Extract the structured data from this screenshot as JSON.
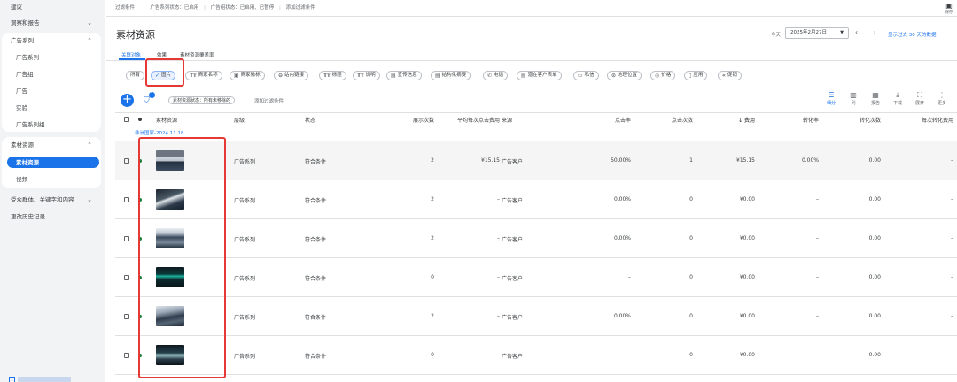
{
  "sidebar": {
    "items_top": [
      {
        "label": "建议"
      },
      {
        "label": "洞察和报告",
        "chev": "⌄"
      }
    ],
    "group_ads": {
      "label": "广告系列",
      "chev": "⌃",
      "items": [
        "广告系列",
        "广告组",
        "广告",
        "实验",
        "广告系列组"
      ]
    },
    "group_assets": {
      "label": "素材资源",
      "chev": "⌃",
      "items": [
        "素材资源",
        "视频"
      ]
    },
    "items_bottom": [
      {
        "label": "受众群体、关键字和内容",
        "chev": "⌄"
      },
      {
        "label": "更改历史记录"
      }
    ]
  },
  "filterbar": {
    "items": [
      "过滤条件",
      "广告系列状态：已启用",
      "广告组状态：已启用、已暂停",
      "添加过滤条件"
    ],
    "save_label": "保存"
  },
  "header": {
    "title": "素材资源",
    "date_prefix": "今天",
    "date_value": "2025年2月27日",
    "date_compare": "显示过去 30 天的数据"
  },
  "tabs": [
    "关联对象",
    "效果",
    "素材资源覆盖率"
  ],
  "type_chips": [
    {
      "icon": "",
      "label": "所有"
    },
    {
      "icon": "✓",
      "label": "图片"
    },
    {
      "icon": "Tт",
      "label": "商家名称"
    },
    {
      "icon": "▣",
      "label": "商家徽标"
    },
    {
      "icon": "⊖",
      "label": "站内链接"
    },
    {
      "icon": "Tт",
      "label": "标题"
    },
    {
      "icon": "Tт",
      "label": "说明"
    },
    {
      "icon": "▤",
      "label": "宣传信息"
    },
    {
      "icon": "▤",
      "label": "结构化摘要"
    },
    {
      "icon": "✆",
      "label": "电话"
    },
    {
      "icon": "▤",
      "label": "潜在客户表单"
    },
    {
      "icon": "▭",
      "label": "私信"
    },
    {
      "icon": "⊙",
      "label": "地理位置"
    },
    {
      "icon": "◎",
      "label": "价格"
    },
    {
      "icon": "▯",
      "label": "应用"
    },
    {
      "icon": "«",
      "label": "促销"
    }
  ],
  "subfilter": {
    "badge": "1",
    "chip": "素材资源状态：所有未移除的",
    "add": "添加过滤条件"
  },
  "toolbar": [
    {
      "icon": "☰",
      "label": "细分"
    },
    {
      "icon": "▥",
      "label": "列"
    },
    {
      "icon": "▦",
      "label": "报告"
    },
    {
      "icon": "⤓",
      "label": "下载"
    },
    {
      "icon": "⛶",
      "label": "展开"
    },
    {
      "icon": "⋮",
      "label": "更多"
    }
  ],
  "columns": {
    "asset": "素材资源",
    "level": "层级",
    "status": "状态",
    "impressions": "展示次数",
    "avg_cpc": "平均每次点击费用",
    "source": "来源",
    "ctr": "点击率",
    "clicks": "点击次数",
    "cost": "费用",
    "conv_rate": "转化率",
    "conversions": "转化次数",
    "cost_per_conv": "每次转化费用"
  },
  "group_label": "非洲国家-2024.11.18",
  "rows": [
    {
      "level": "广告系列",
      "status": "符合条件",
      "impressions": "2",
      "avg_cpc": "¥15.15",
      "source": "广告客户",
      "ctr": "50.00%",
      "clicks": "1",
      "cost": "¥15.15",
      "conv_rate": "0.00%",
      "conversions": "0.00",
      "cost_per_conv": "–",
      "thumb": "a"
    },
    {
      "level": "广告系列",
      "status": "符合条件",
      "impressions": "2",
      "avg_cpc": "–",
      "source": "广告客户",
      "ctr": "0.00%",
      "clicks": "0",
      "cost": "¥0.00",
      "conv_rate": "–",
      "conversions": "0.00",
      "cost_per_conv": "–",
      "thumb": "b"
    },
    {
      "level": "广告系列",
      "status": "符合条件",
      "impressions": "2",
      "avg_cpc": "–",
      "source": "广告客户",
      "ctr": "0.00%",
      "clicks": "0",
      "cost": "¥0.00",
      "conv_rate": "–",
      "conversions": "0.00",
      "cost_per_conv": "–",
      "thumb": "c"
    },
    {
      "level": "广告系列",
      "status": "符合条件",
      "impressions": "0",
      "avg_cpc": "–",
      "source": "广告客户",
      "ctr": "–",
      "clicks": "0",
      "cost": "¥0.00",
      "conv_rate": "–",
      "conversions": "0.00",
      "cost_per_conv": "–",
      "thumb": "d"
    },
    {
      "level": "广告系列",
      "status": "符合条件",
      "impressions": "2",
      "avg_cpc": "–",
      "source": "广告客户",
      "ctr": "0.00%",
      "clicks": "0",
      "cost": "¥0.00",
      "conv_rate": "–",
      "conversions": "0.00",
      "cost_per_conv": "–",
      "thumb": "e"
    },
    {
      "level": "广告系列",
      "status": "符合条件",
      "impressions": "0",
      "avg_cpc": "–",
      "source": "广告客户",
      "ctr": "–",
      "clicks": "0",
      "cost": "¥0.00",
      "conv_rate": "–",
      "conversions": "0.00",
      "cost_per_conv": "–",
      "thumb": "f"
    }
  ],
  "colors": {
    "accent": "#1a73e8",
    "highlight": "#e53935",
    "eligible": "#188038"
  }
}
